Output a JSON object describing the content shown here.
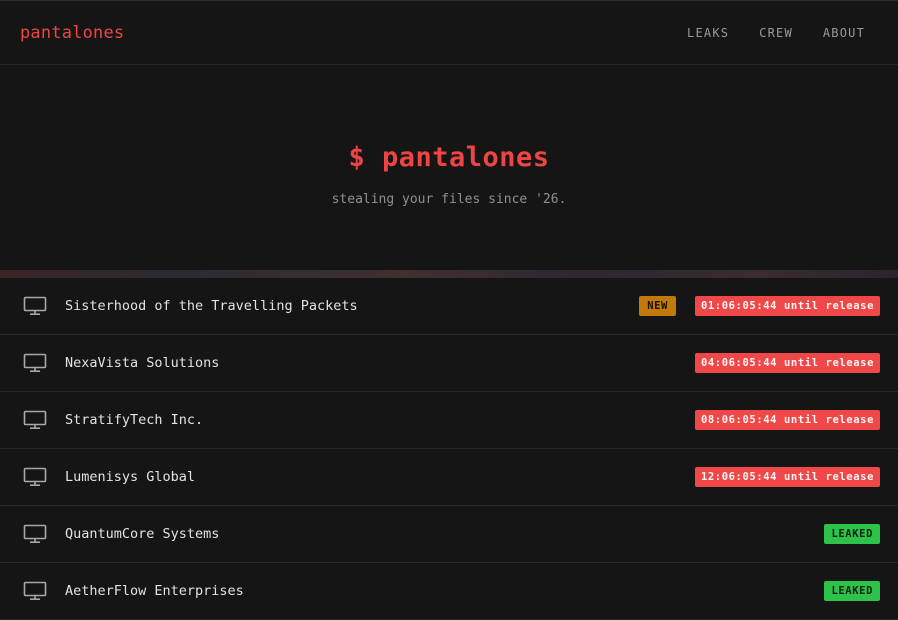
{
  "brand": "pantalones",
  "nav": {
    "items": [
      "LEAKS",
      "CREW",
      "ABOUT"
    ]
  },
  "hero": {
    "title": "$ pantalones",
    "subtitle": "stealing your files since '26."
  },
  "icons": {
    "row_icon": "monitor-icon"
  },
  "colors": {
    "accent": "#ef4444",
    "new_badge": "#c2780a",
    "countdown_badge": "#f04848",
    "leaked_badge": "#2ec24a",
    "background": "#151515"
  },
  "leaks": [
    {
      "name": "Sisterhood of the Travelling Packets",
      "tag": "NEW",
      "status": "01:06:05:44 until release"
    },
    {
      "name": "NexaVista Solutions",
      "status": "04:06:05:44 until release"
    },
    {
      "name": "StratifyTech Inc.",
      "status": "08:06:05:44 until release"
    },
    {
      "name": "Lumenisys Global",
      "status": "12:06:05:44 until release"
    },
    {
      "name": "QuantumCore Systems",
      "status": "LEAKED"
    },
    {
      "name": "AetherFlow Enterprises",
      "status": "LEAKED"
    }
  ]
}
